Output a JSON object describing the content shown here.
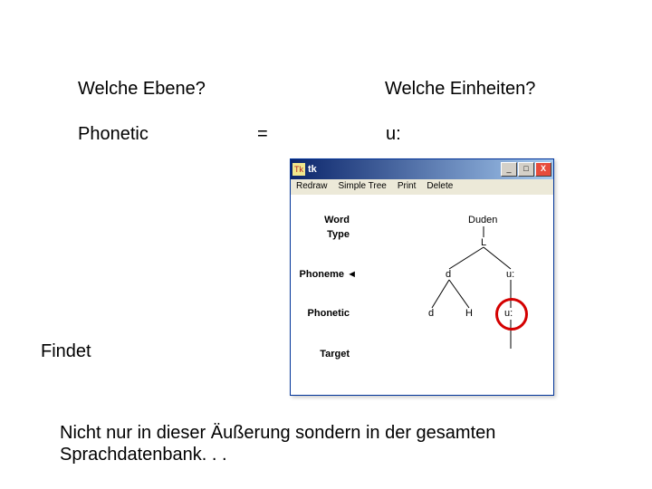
{
  "slide": {
    "q_left": "Welche Ebene?",
    "q_right": "Welche Einheiten?",
    "a_left": "Phonetic",
    "eq": "=",
    "a_right": "u:",
    "findet": "Findet",
    "note": "Nicht nur in dieser Äußerung sondern in der gesamten Sprachdatenbank. . ."
  },
  "tk": {
    "title": "tk",
    "icon_text": "Tk",
    "btn_min": "_",
    "btn_max": "□",
    "btn_close": "X",
    "menus": [
      "Redraw",
      "Simple Tree",
      "Print",
      "Delete"
    ],
    "row_labels": [
      "Word",
      "Type",
      "Phoneme ◄",
      "Phonetic",
      "Target"
    ],
    "nodes": {
      "word": "Duden",
      "type": "L",
      "phonemes": [
        "d",
        "u:"
      ],
      "phonetic": [
        "d",
        "H",
        "u:"
      ],
      "target": ""
    }
  }
}
